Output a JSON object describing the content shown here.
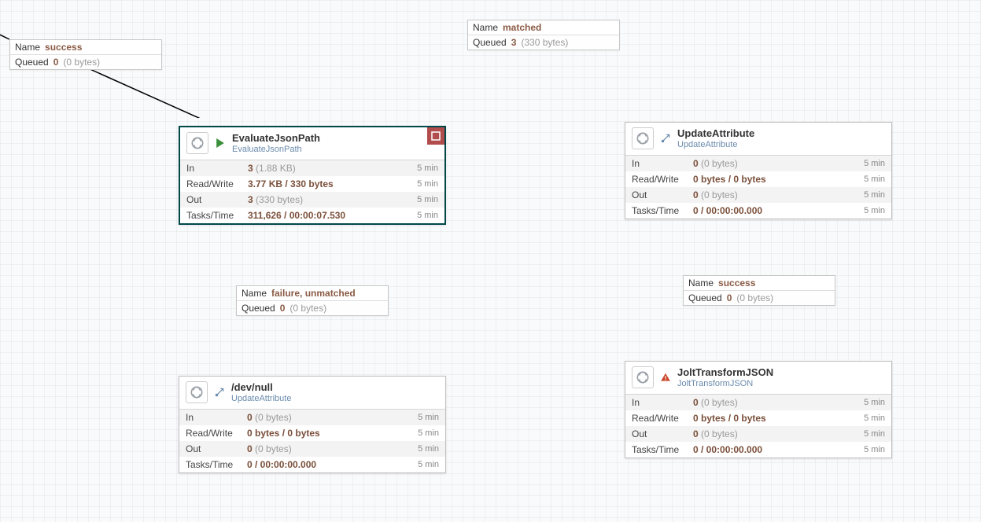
{
  "connections": {
    "c1": {
      "name_label": "Name",
      "name": "success",
      "queued_label": "Queued",
      "count": "0",
      "size": "(0 bytes)"
    },
    "c2": {
      "name_label": "Name",
      "name": "matched",
      "queued_label": "Queued",
      "count": "3",
      "size": "(330 bytes)"
    },
    "c3": {
      "name_label": "Name",
      "name": "failure, unmatched",
      "queued_label": "Queued",
      "count": "0",
      "size": "(0 bytes)"
    },
    "c4": {
      "name_label": "Name",
      "name": "success",
      "queued_label": "Queued",
      "count": "0",
      "size": "(0 bytes)"
    }
  },
  "processors": {
    "p1": {
      "name": "EvaluateJsonPath",
      "type": "EvaluateJsonPath",
      "rows": {
        "in": {
          "label": "In",
          "value": "3",
          "size": "(1.88 KB)",
          "time": "5 min"
        },
        "rw": {
          "label": "Read/Write",
          "value": "3.77 KB / 330 bytes",
          "size": "",
          "time": "5 min"
        },
        "out": {
          "label": "Out",
          "value": "3",
          "size": "(330 bytes)",
          "time": "5 min"
        },
        "tt": {
          "label": "Tasks/Time",
          "value": "311,626 / 00:00:07.530",
          "size": "",
          "time": "5 min"
        }
      }
    },
    "p2": {
      "name": "UpdateAttribute",
      "type": "UpdateAttribute",
      "rows": {
        "in": {
          "label": "In",
          "value": "0",
          "size": "(0 bytes)",
          "time": "5 min"
        },
        "rw": {
          "label": "Read/Write",
          "value": "0 bytes / 0 bytes",
          "size": "",
          "time": "5 min"
        },
        "out": {
          "label": "Out",
          "value": "0",
          "size": "(0 bytes)",
          "time": "5 min"
        },
        "tt": {
          "label": "Tasks/Time",
          "value": "0 / 00:00:00.000",
          "size": "",
          "time": "5 min"
        }
      }
    },
    "p3": {
      "name": "/dev/null",
      "type": "UpdateAttribute",
      "rows": {
        "in": {
          "label": "In",
          "value": "0",
          "size": "(0 bytes)",
          "time": "5 min"
        },
        "rw": {
          "label": "Read/Write",
          "value": "0 bytes / 0 bytes",
          "size": "",
          "time": "5 min"
        },
        "out": {
          "label": "Out",
          "value": "0",
          "size": "(0 bytes)",
          "time": "5 min"
        },
        "tt": {
          "label": "Tasks/Time",
          "value": "0 / 00:00:00.000",
          "size": "",
          "time": "5 min"
        }
      }
    },
    "p4": {
      "name": "JoltTransformJSON",
      "type": "JoltTransformJSON",
      "rows": {
        "in": {
          "label": "In",
          "value": "0",
          "size": "(0 bytes)",
          "time": "5 min"
        },
        "rw": {
          "label": "Read/Write",
          "value": "0 bytes / 0 bytes",
          "size": "",
          "time": "5 min"
        },
        "out": {
          "label": "Out",
          "value": "0",
          "size": "(0 bytes)",
          "time": "5 min"
        },
        "tt": {
          "label": "Tasks/Time",
          "value": "0 / 00:00:00.000",
          "size": "",
          "time": "5 min"
        }
      }
    }
  }
}
